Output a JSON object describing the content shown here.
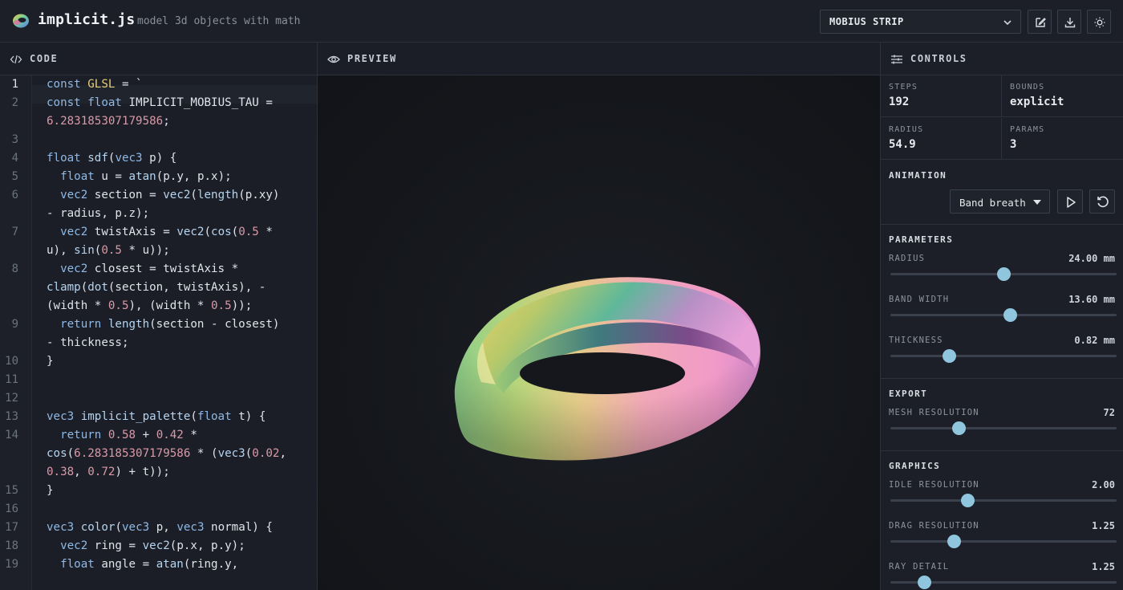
{
  "app": {
    "name": "implicit.js",
    "tagline": "model 3d objects with math"
  },
  "toolbar": {
    "shape_select_value": "MOBIUS STRIP",
    "buttons": [
      "edit-icon",
      "download-icon",
      "sun-icon"
    ]
  },
  "code_panel": {
    "title": "CODE",
    "active_line": 1,
    "lines": [
      {
        "n": "1",
        "html": "<span class='k'>const</span> <span class='f'>GLSL</span> = `"
      },
      {
        "n": "2",
        "html": "<span class='k'>const</span> <span class='k'>float</span> IMPLICIT_MOBIUS_TAU ="
      },
      {
        "n": "",
        "html": "<span class='n'>6.283185307179586</span>;"
      },
      {
        "n": "3",
        "html": ""
      },
      {
        "n": "4",
        "html": "<span class='k'>float</span> <span class='fn'>sdf</span>(<span class='k'>vec3</span> p) {"
      },
      {
        "n": "5",
        "html": "  <span class='k'>float</span> u = <span class='fn'>atan</span>(p.y, p.x);"
      },
      {
        "n": "6",
        "html": "  <span class='k'>vec2</span> section = <span class='fn'>vec2</span>(<span class='fn'>length</span>(p.xy)"
      },
      {
        "n": "",
        "html": "- radius, p.z);"
      },
      {
        "n": "7",
        "html": "  <span class='k'>vec2</span> twistAxis = <span class='fn'>vec2</span>(<span class='fn'>cos</span>(<span class='n'>0.5</span> *"
      },
      {
        "n": "",
        "html": "u), <span class='fn'>sin</span>(<span class='n'>0.5</span> * u));"
      },
      {
        "n": "8",
        "html": "  <span class='k'>vec2</span> closest = twistAxis *"
      },
      {
        "n": "",
        "html": "<span class='fn'>clamp</span>(<span class='fn'>dot</span>(section, twistAxis), -"
      },
      {
        "n": "",
        "html": "(width * <span class='n'>0.5</span>), (width * <span class='n'>0.5</span>));"
      },
      {
        "n": "9",
        "html": "  <span class='k'>return</span> <span class='fn'>length</span>(section - closest)"
      },
      {
        "n": "",
        "html": "- thickness;"
      },
      {
        "n": "10",
        "html": "}"
      },
      {
        "n": "11",
        "html": ""
      },
      {
        "n": "12",
        "html": ""
      },
      {
        "n": "13",
        "html": "<span class='k'>vec3</span> <span class='fn'>implicit_palette</span>(<span class='k'>float</span> t) {"
      },
      {
        "n": "14",
        "html": "  <span class='k'>return</span> <span class='n'>0.58</span> + <span class='n'>0.42</span> *"
      },
      {
        "n": "",
        "html": "<span class='fn'>cos</span>(<span class='n'>6.283185307179586</span> * (<span class='fn'>vec3</span>(<span class='n'>0.02</span>,"
      },
      {
        "n": "",
        "html": "<span class='n'>0.38</span>, <span class='n'>0.72</span>) + t));"
      },
      {
        "n": "15",
        "html": "}"
      },
      {
        "n": "16",
        "html": ""
      },
      {
        "n": "17",
        "html": "<span class='k'>vec3</span> <span class='fn'>color</span>(<span class='k'>vec3</span> p, <span class='k'>vec3</span> normal) {"
      },
      {
        "n": "18",
        "html": "  <span class='k'>vec2</span> ring = <span class='fn'>vec2</span>(p.x, p.y);"
      },
      {
        "n": "19",
        "html": "  <span class='k'>float</span> angle = <span class='fn'>atan</span>(ring.y,"
      }
    ]
  },
  "preview_panel": {
    "title": "PREVIEW"
  },
  "controls_panel": {
    "title": "CONTROLS",
    "stats": {
      "steps_label": "STEPS",
      "steps_value": "192",
      "bounds_label": "BOUNDS",
      "bounds_value": "explicit",
      "radius_label": "RADIUS",
      "radius_value": "54.9",
      "params_label": "PARAMS",
      "params_value": "3"
    },
    "animation": {
      "title": "ANIMATION",
      "select_value": "Band breath"
    },
    "parameters": {
      "title": "PARAMETERS",
      "sliders": [
        {
          "label": "RADIUS",
          "value": "24.00 mm",
          "fraction": 0.5
        },
        {
          "label": "BAND WIDTH",
          "value": "13.60 mm",
          "fraction": 0.53
        },
        {
          "label": "THICKNESS",
          "value": "0.82 mm",
          "fraction": 0.26
        }
      ]
    },
    "export": {
      "title": "EXPORT",
      "sliders": [
        {
          "label": "MESH RESOLUTION",
          "value": "72",
          "fraction": 0.3
        }
      ]
    },
    "graphics": {
      "title": "GRAPHICS",
      "sliders": [
        {
          "label": "IDLE RESOLUTION",
          "value": "2.00",
          "fraction": 0.34
        },
        {
          "label": "DRAG RESOLUTION",
          "value": "1.25",
          "fraction": 0.28
        },
        {
          "label": "RAY DETAIL",
          "value": "1.25",
          "fraction": 0.15
        }
      ]
    }
  },
  "colors": {
    "accent_thumb": "#8fc6de",
    "keyword": "#8fb9e6",
    "number": "#d99aa8",
    "string_const": "#e6cf7a"
  }
}
